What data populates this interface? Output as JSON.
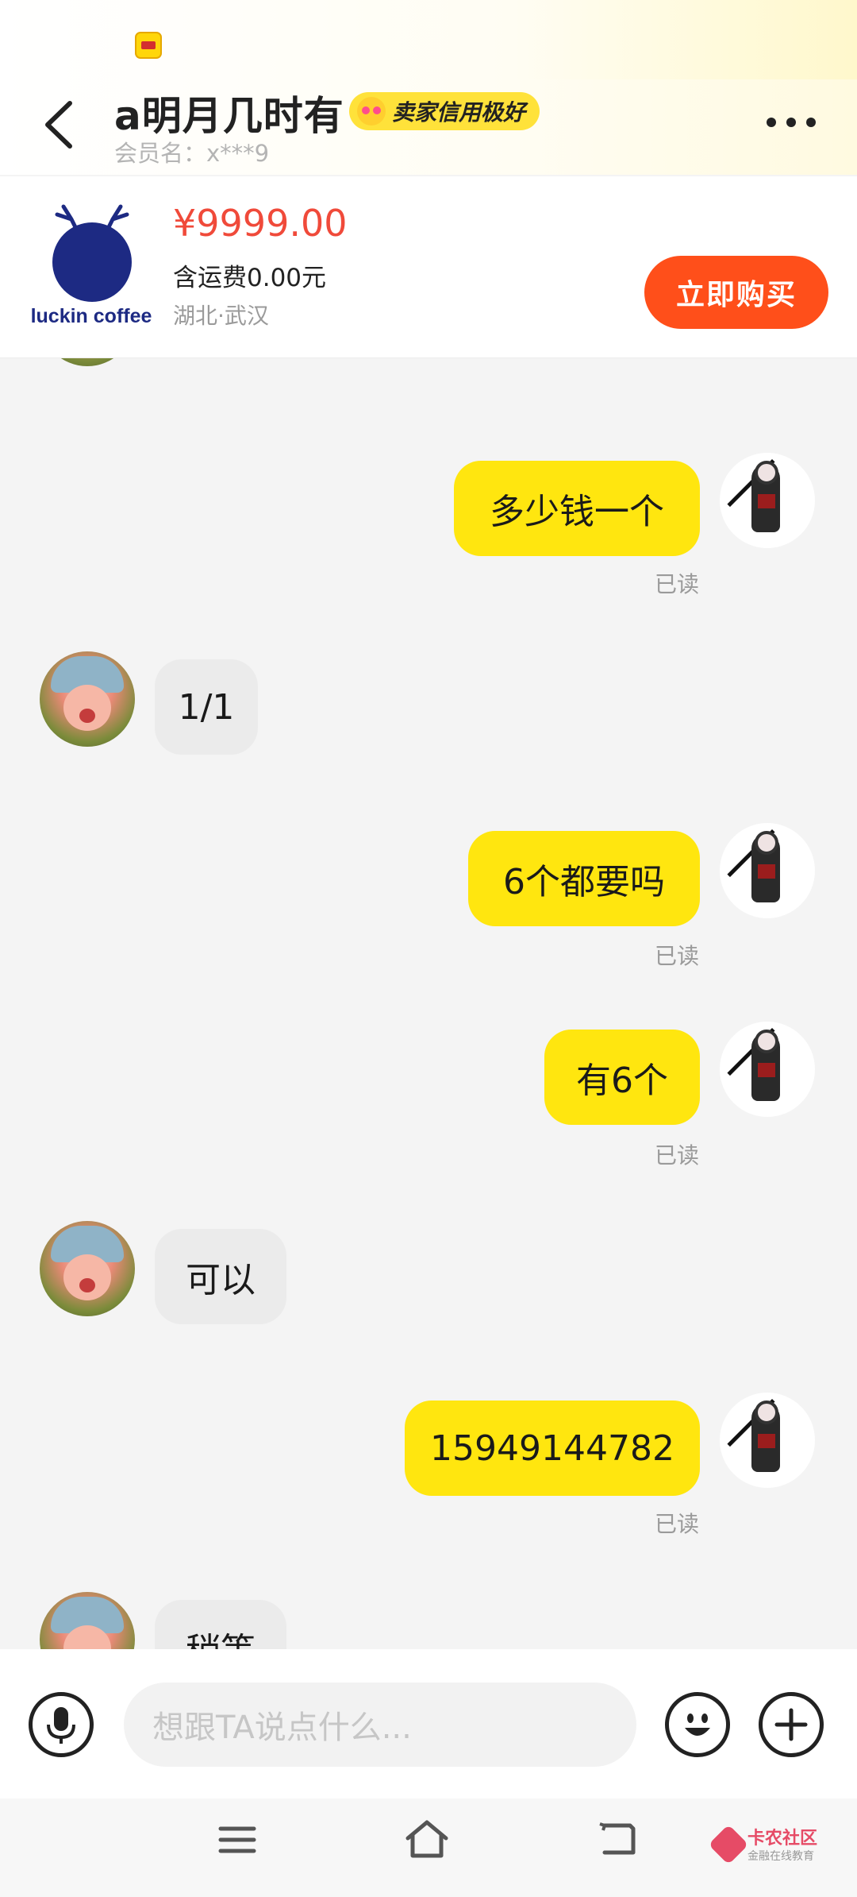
{
  "header": {
    "title": "a明月几时有",
    "badge": "卖家信用极好",
    "member_label": "会员名：x***9"
  },
  "product": {
    "logo_text": "luckin coffee",
    "price": "¥9999.00",
    "shipping": "含运费0.00元",
    "location": "湖北·武汉",
    "buy_label": "立即购买"
  },
  "messages": [
    {
      "from": "me",
      "text": "多少钱一个",
      "status": "已读"
    },
    {
      "from": "other",
      "text": "1/1"
    },
    {
      "from": "me",
      "text": "6个都要吗",
      "status": "已读"
    },
    {
      "from": "me",
      "text": "有6个",
      "status": "已读"
    },
    {
      "from": "other",
      "text": "可以"
    },
    {
      "from": "me",
      "text": "15949144782",
      "status": "已读"
    },
    {
      "from": "other",
      "text": "稍等"
    }
  ],
  "input": {
    "placeholder": "想跟TA说点什么..."
  },
  "watermark": {
    "name": "卡农社区",
    "tagline": "金融在线教育"
  },
  "colors": {
    "my_bubble": "#ffe60f",
    "other_bubble": "#ebebeb",
    "price": "#f04a3a",
    "buy_button": "#ff4f1a",
    "badge": "#ffe23a"
  },
  "icons": [
    "back-arrow-icon",
    "more-icon",
    "voice-icon",
    "emoji-icon",
    "plus-icon",
    "nav-menu-icon",
    "nav-home-icon",
    "nav-back-icon"
  ]
}
